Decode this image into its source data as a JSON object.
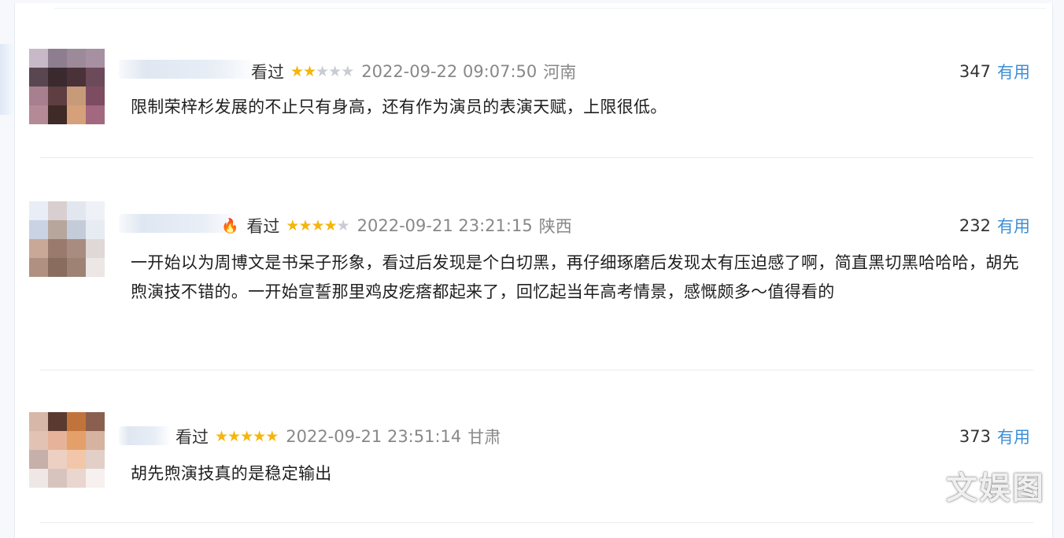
{
  "comments": [
    {
      "status": "看过",
      "rating": 2,
      "time": "2022-09-22 09:07:50",
      "location": "河南",
      "votes": "347",
      "vote_label": "有用",
      "text": "限制荣梓杉发展的不止只有身高，还有作为演员的表演天赋，上限很低。"
    },
    {
      "status": "看过",
      "rating": 4,
      "time": "2022-09-21 23:21:15",
      "location": "陕西",
      "votes": "232",
      "vote_label": "有用",
      "text": "一开始以为周博文是书呆子形象，看过后发现是个白切黑，再仔细琢磨后发现太有压迫感了啊，简直黑切黑哈哈哈，胡先煦演技不错的。一开始宣誓那里鸡皮疙瘩都起来了，回忆起当年高考情景，感慨颇多～值得看的"
    },
    {
      "status": "看过",
      "rating": 5,
      "time": "2022-09-21 23:51:14",
      "location": "甘肃",
      "votes": "373",
      "vote_label": "有用",
      "text": "胡先煦演技真的是稳定输出"
    }
  ],
  "stars": {
    "comment1": "★★☆☆☆",
    "comment2": "★★★★☆",
    "comment3": "★★★★★"
  },
  "colors": {
    "accent_link": "#3d8fd5",
    "star_on": "#f5b60b",
    "star_off": "#c9ccd2",
    "badge": "#e8541c"
  },
  "icons": {
    "badge": "flame-badge-icon"
  },
  "watermark": "文娱图"
}
